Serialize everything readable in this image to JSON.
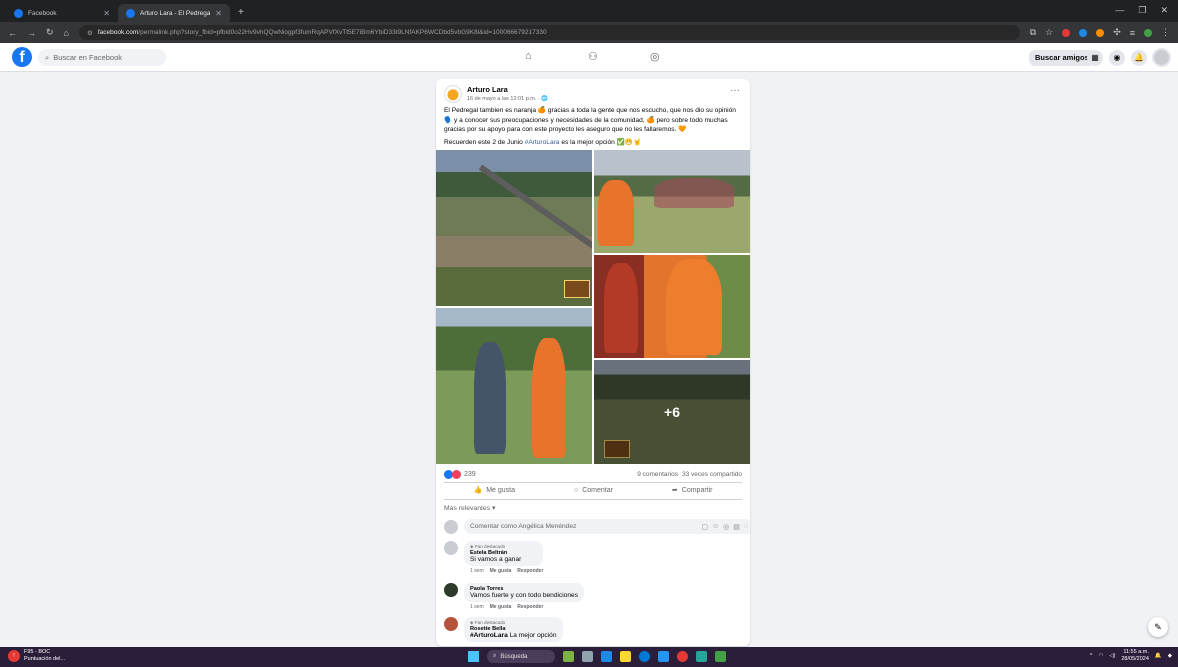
{
  "browser": {
    "tabs": [
      {
        "label": "Facebook",
        "active": false
      },
      {
        "label": "Arturo Lara - El Pedregal tambi...",
        "active": true
      }
    ],
    "url_host": "facebook.com",
    "url_path": "/permalink.php?story_fbid=pfbid0o22Hv9vhQQwNiogpf3fumRqAPVfXvTt5E7iBm6YbiD33t9LNfAKP6WCDbd5vbG9K8i&id=100066679217330"
  },
  "fb_nav": {
    "search_placeholder": "Buscar en Facebook",
    "find_friends": "Buscar amigos"
  },
  "post": {
    "author": "Arturo Lara",
    "date": "16 de mayo a las 12:01 p.m.",
    "text": "El Pedregal tambien es naranja 🍊 gracias a toda la gente que nos escucho, que nos dio su opinión 🗣️ y a conocer sus preocupaciones y necesidades de la comunidad, 🍊 pero sobre todo muchas gracias por su apoyo para con este proyecto les aseguro que no les fallaremos. 🧡",
    "text2_prefix": "Recuerden este 2 de Junio ",
    "text2_tag": "#ArturoLara",
    "text2_suffix": " es la mejor opción ✅😁🤘",
    "more_photos": "+6",
    "reactions_count": "239",
    "comments_count": "9 comentarios",
    "shares_count": "33 veces compartido",
    "like_label": "Me gusta",
    "comment_label": "Comentar",
    "share_label": "Compartir",
    "sort_label": "Más relevantes ▾",
    "comment_placeholder": "Comentar como Angélica Menéndez"
  },
  "comments": [
    {
      "badge": "Fan destacado",
      "name": "Estela Beltrán",
      "text": "Si vamos a ganar",
      "time": "1 sem",
      "like": "Me gusta",
      "reply": "Responder"
    },
    {
      "badge": "",
      "name": "Paola Torres",
      "text": "Vamos fuerte y con todo bendiciones",
      "time": "1 sem",
      "like": "Me gusta",
      "reply": "Responder"
    },
    {
      "badge": "Fan destacado",
      "name": "Rosette Bella",
      "text_tag": "#ArturoLara",
      "text": " La mejor opción"
    }
  ],
  "taskbar": {
    "weather_title": "F95 - BOC",
    "weather_sub": "Puntuación del...",
    "search_label": "Búsqueda",
    "time": "11:55 a.m.",
    "date": "28/05/2024"
  },
  "colors": {
    "fb_blue": "#1877f2",
    "page_bg": "#f0f2f5",
    "taskbar": "#2b1e3b"
  }
}
